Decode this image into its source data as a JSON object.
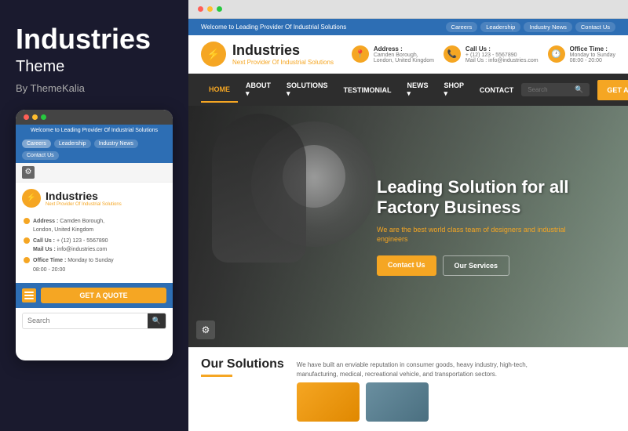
{
  "left": {
    "title": "Industries",
    "subtitle": "Theme",
    "by": "By ThemeKalia"
  },
  "mobile": {
    "announcement": "Welcome to Leading Provider Of Industrial Solutions",
    "pills": [
      "Careers",
      "Leadership",
      "Industry News",
      "Contact Us"
    ],
    "logo": {
      "icon": "⚡",
      "name": "Industries",
      "tagline": "Next Provider Of Industrial Solutions"
    },
    "contact": [
      {
        "icon": "📍",
        "label": "Address :",
        "value": "Camden Borough, London, United Kingdom"
      },
      {
        "icon": "📞",
        "label": "Call Us :",
        "value": "+ (12) 123 - 5567890"
      },
      {
        "icon": "✉",
        "label": "Mail Us :",
        "value": "info@industries.com"
      },
      {
        "icon": "🕐",
        "label": "Office Time :",
        "value": "Monday to Sunday 08:00 - 20:00"
      }
    ],
    "cta": "GET A QUOTE",
    "search_placeholder": "Search"
  },
  "desktop": {
    "announcement": "Welcome to Leading Provider Of Industrial Solutions",
    "announcement_links": [
      "Careers",
      "Leadership",
      "Industry News",
      "Contact Us"
    ],
    "logo": {
      "icon": "⚡",
      "name": "Industries",
      "tagline": "Next Provider Of Industrial Solutions"
    },
    "header_info": [
      {
        "icon": "📍",
        "label": "Address :",
        "sub": "Camden Borough, London, United Kingdom"
      },
      {
        "icon": "📞",
        "label": "Call Us :",
        "sub": "+ (12) 123 - 5567890\nMail Us : info@industries.com"
      },
      {
        "icon": "🕐",
        "label": "Office Time :",
        "sub": "Monday to Sunday\n08:00 - 20:00"
      }
    ],
    "nav": {
      "items": [
        "HOME",
        "ABOUT",
        "SOLUTIONS",
        "TESTIMONIAL",
        "NEWS",
        "SHOP",
        "CONTACT"
      ],
      "search_placeholder": "Search",
      "cta": "GET A QUOTE"
    },
    "hero": {
      "title": "Leading Solution for all Factory Business",
      "desc": "We are the best world class team of designers and industrial engineers",
      "btn1": "Contact Us",
      "btn2": "Our Services"
    },
    "solutions": {
      "title": "Our Solutions",
      "desc": "We have built an enviable reputation in consumer goods, heavy industry, high-tech, manufacturing, medical, recreational vehicle, and transportation sectors."
    }
  }
}
